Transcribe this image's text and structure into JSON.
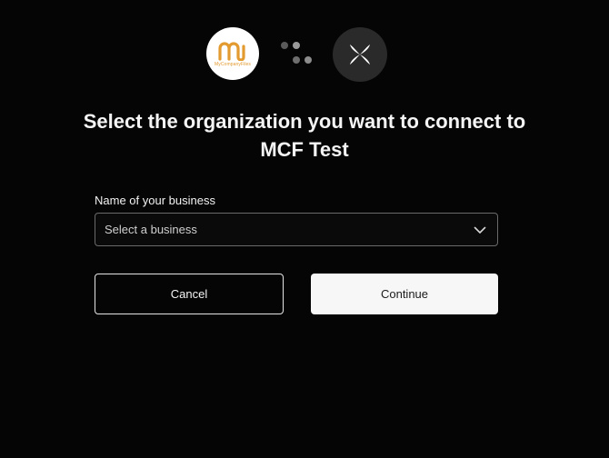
{
  "logos": {
    "left_brand_text": "MyCompanyFiles",
    "left_brand_color": "#e39a2f",
    "left_icon": "mycompanyfiles-logo-icon",
    "connector_icon": "connecting-dots-icon",
    "right_icon": "xero-x-icon",
    "right_bg_color": "#2a2a2a"
  },
  "header": {
    "title": "Select the organization you want to connect to MCF Test"
  },
  "form": {
    "business_label": "Name of your business",
    "business_select_placeholder": "Select a business",
    "business_select_icon": "chevron-down-icon"
  },
  "actions": {
    "cancel_label": "Cancel",
    "continue_label": "Continue"
  },
  "colors": {
    "background": "#050505",
    "continue_bg": "#f7f7f7",
    "select_border": "#6a6a6a"
  }
}
